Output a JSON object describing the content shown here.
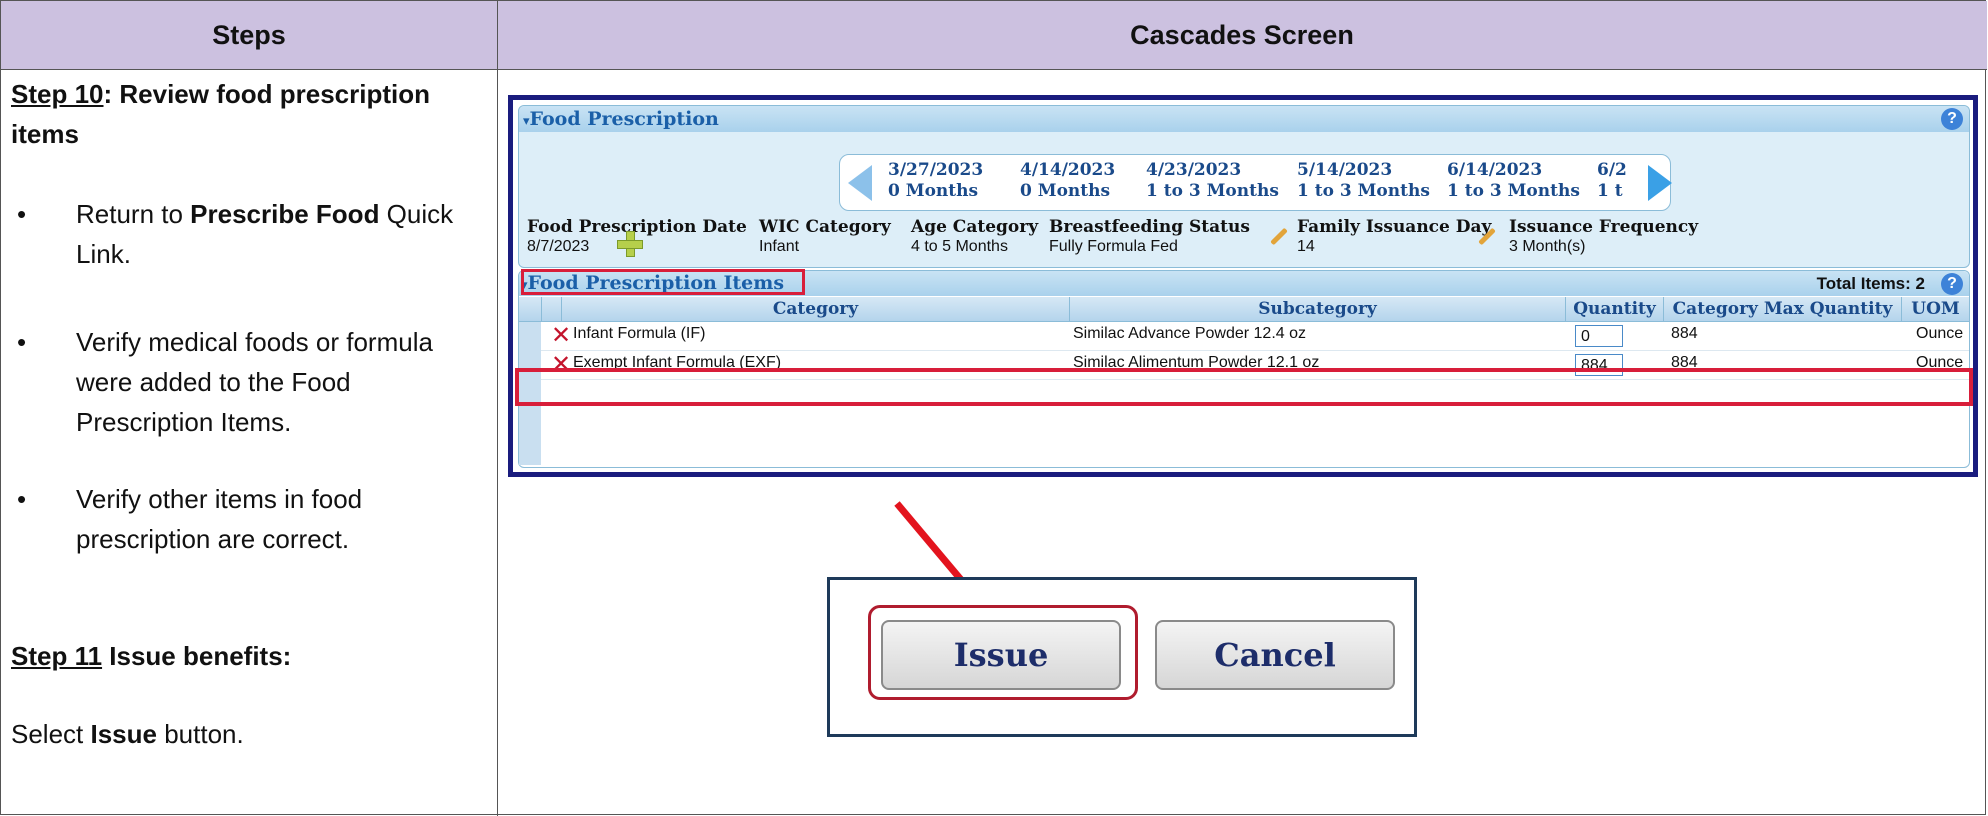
{
  "table": {
    "col_steps": "Steps",
    "col_screen": "Cascades Screen"
  },
  "steps": {
    "step10_label": "Step 10",
    "step10_rest": ": Review food prescription items",
    "bullets": [
      {
        "before": "Return to ",
        "bold": "Prescribe Food",
        "after": " Quick Link."
      },
      {
        "before": "Verify medical foods or formula were added to the Food Prescription Items.",
        "bold": "",
        "after": ""
      },
      {
        "before": "Verify other items in food prescription are correct.",
        "bold": "",
        "after": ""
      }
    ],
    "bullet_char": "•",
    "step11_label": "Step 11",
    "step11_rest": " Issue benefits:",
    "select_before": "Select ",
    "select_bold": "Issue",
    "select_after": " button."
  },
  "food_prescription": {
    "title": "Food Prescription",
    "collapse_glyph": "▾",
    "help": "?",
    "dates": [
      {
        "date": "3/27/2023",
        "range": "0 Months"
      },
      {
        "date": "4/14/2023",
        "range": "0 Months"
      },
      {
        "date": "4/23/2023",
        "range": "1 to 3 Months"
      },
      {
        "date": "5/14/2023",
        "range": "1 to 3 Months"
      },
      {
        "date": "6/14/2023",
        "range": "1 to 3 Months"
      },
      {
        "date": "6/2",
        "range": "1 t"
      }
    ],
    "fields": [
      {
        "label": "Food Prescription Date",
        "value": "8/7/2023"
      },
      {
        "label": "WIC Category",
        "value": "Infant"
      },
      {
        "label": "Age Category",
        "value": "4 to 5 Months"
      },
      {
        "label": "Breastfeeding Status",
        "value": "Fully Formula Fed"
      },
      {
        "label": "Family Issuance Day",
        "value": "14"
      },
      {
        "label": "Issuance Frequency",
        "value": "3  Month(s)"
      }
    ]
  },
  "items": {
    "title": "Food Prescription Items",
    "collapse_glyph": "▾",
    "total_label": "Total Items:",
    "total_value": "2",
    "help": "?",
    "columns": [
      "Category",
      "Subcategory",
      "Quantity",
      "Category Max Quantity",
      "UOM"
    ],
    "rows": [
      {
        "category": "Infant Formula (IF)",
        "subcategory": "Similac Advance Powder 12.4 oz",
        "quantity": "0",
        "max": "884",
        "uom": "Ounce"
      },
      {
        "category": "Exempt Infant Formula (EXF)",
        "subcategory": "Similac Alimentum Powder 12.1 oz",
        "quantity": "884",
        "max": "884",
        "uom": "Ounce"
      }
    ],
    "delete_glyph": "✕"
  },
  "buttons": {
    "issue": "Issue",
    "cancel": "Cancel"
  },
  "colors": {
    "header_bg": "#ccc1e0",
    "highlight_red": "#d81e3a",
    "panel_border": "#1a1c7e",
    "accent_blue": "#1a5fa8"
  }
}
